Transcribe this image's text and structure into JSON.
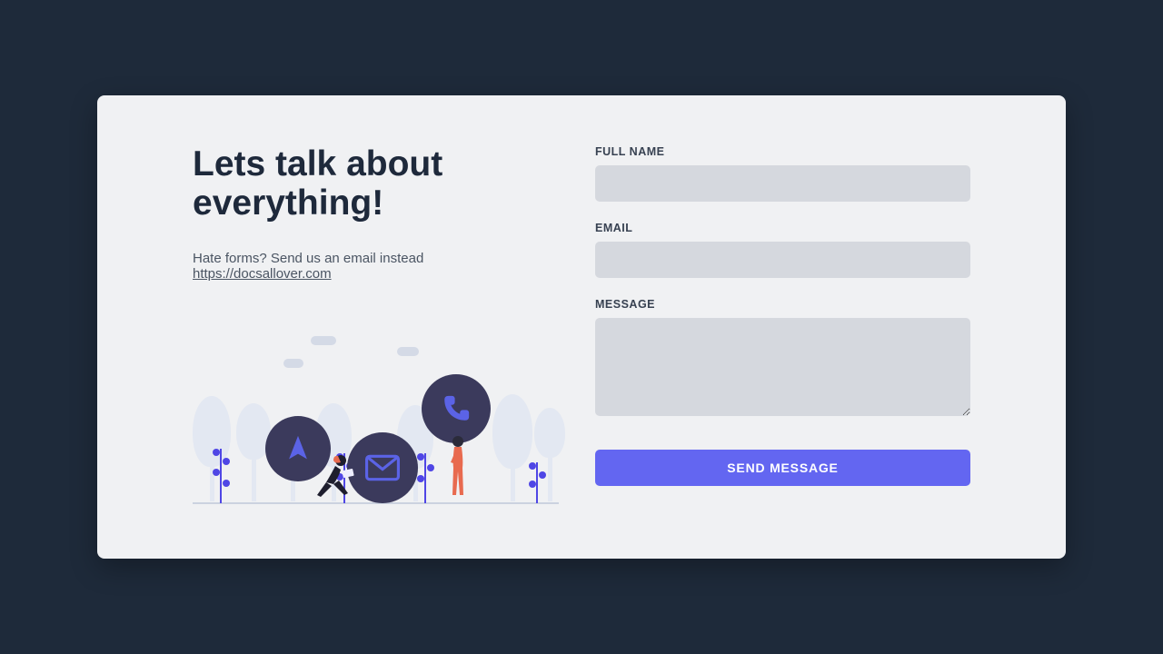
{
  "heading": "Lets talk about everything!",
  "subtext_prefix": "Hate forms? Send us an email instead ",
  "subtext_link": "https://docsallover.com",
  "form": {
    "fullname_label": "FULL NAME",
    "fullname_value": "",
    "email_label": "EMAIL",
    "email_value": "",
    "message_label": "MESSAGE",
    "message_value": "",
    "submit_label": "SEND MESSAGE"
  },
  "colors": {
    "page_bg": "#1e2a3a",
    "card_bg": "#f0f1f3",
    "accent": "#6366f1",
    "input_bg": "#d5d8de",
    "heading": "#1e293b"
  }
}
